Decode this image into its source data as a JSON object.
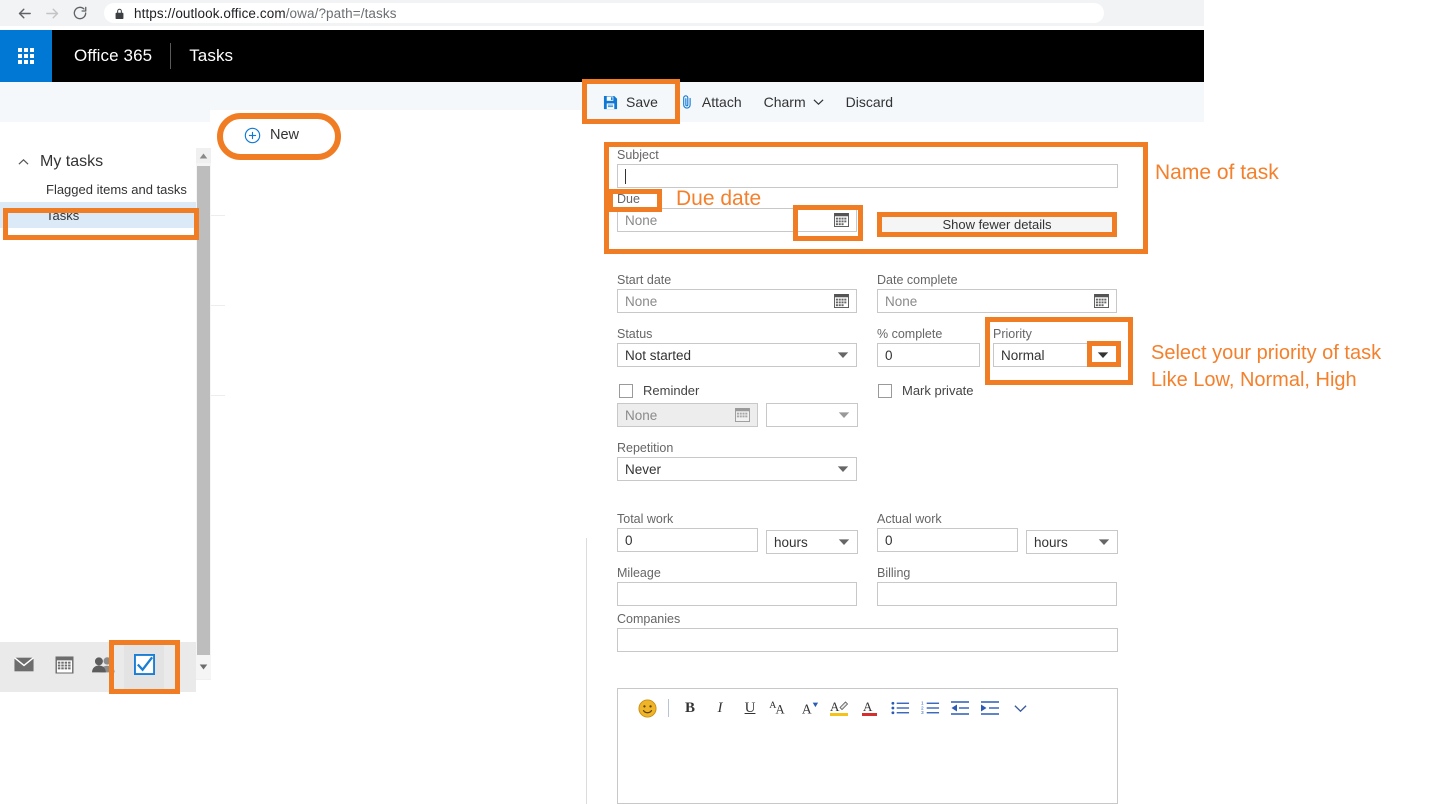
{
  "browser": {
    "back_icon": "arrow-left-icon",
    "forward_icon": "arrow-right-icon",
    "reload_icon": "reload-icon",
    "lock_icon": "lock-icon",
    "url_scheme": "https://outlook.office.com",
    "url_path": "/owa/?path=/tasks",
    "url_full": "https://outlook.office.com/owa/?path=/tasks"
  },
  "suite_bar": {
    "waffle_icon": "app-launcher-icon",
    "brand": "Office 365",
    "app_name": "Tasks"
  },
  "command_bar": {
    "items": [
      {
        "label": "Save",
        "icon": "save-icon",
        "has_chevron": false
      },
      {
        "label": "Attach",
        "icon": "paperclip-icon",
        "has_chevron": false
      },
      {
        "label": "Charm",
        "icon": "",
        "has_chevron": true
      },
      {
        "label": "Discard",
        "icon": "",
        "has_chevron": false
      }
    ]
  },
  "list_pane": {
    "new_button": {
      "label": "New",
      "icon": "plus-circle-icon"
    }
  },
  "sidebar": {
    "group": {
      "label": "My tasks",
      "caret_icon": "chevron-up-icon"
    },
    "items": [
      {
        "label": "Flagged items and tasks",
        "selected": false
      },
      {
        "label": "Tasks",
        "selected": true
      }
    ],
    "scrollbar": {
      "up_icon": "scroll-up-arrow-icon",
      "down_icon": "scroll-down-arrow-icon"
    },
    "modules": [
      {
        "name": "mail-module",
        "icon": "envelope-icon",
        "active": false
      },
      {
        "name": "calendar-module",
        "icon": "calendar-icon",
        "active": false
      },
      {
        "name": "people-module",
        "icon": "people-icon",
        "active": false
      },
      {
        "name": "tasks-module",
        "icon": "checkbox-checked-icon",
        "active": true
      }
    ],
    "overflow_icon": "chevron-down-icon"
  },
  "form": {
    "subject": {
      "label": "Subject",
      "value": "",
      "placeholder": ""
    },
    "due": {
      "label": "Due",
      "value": "None",
      "calendar_icon": "calendar-picker-icon"
    },
    "show_details_button": {
      "label": "Show fewer details"
    },
    "start_date": {
      "label": "Start date",
      "value": "None",
      "calendar_icon": "calendar-picker-icon"
    },
    "date_complete": {
      "label": "Date complete",
      "value": "None",
      "calendar_icon": "calendar-picker-icon"
    },
    "status": {
      "label": "Status",
      "value": "Not started",
      "dropdown_icon": "chevron-down-icon"
    },
    "percent_complete": {
      "label": "% complete",
      "value": "0"
    },
    "priority": {
      "label": "Priority",
      "value": "Normal",
      "dropdown_icon": "chevron-down-icon"
    },
    "reminder": {
      "label": "Reminder",
      "checked": false,
      "date_value": "None",
      "calendar_icon": "calendar-picker-icon",
      "time_value": "",
      "dropdown_icon": "chevron-down-icon"
    },
    "mark_private": {
      "label": "Mark private",
      "checked": false
    },
    "repetition": {
      "label": "Repetition",
      "value": "Never",
      "dropdown_icon": "chevron-down-icon"
    },
    "total_work": {
      "label": "Total work",
      "value": "0",
      "unit": "hours",
      "dropdown_icon": "chevron-down-icon"
    },
    "actual_work": {
      "label": "Actual work",
      "value": "0",
      "unit": "hours",
      "dropdown_icon": "chevron-down-icon"
    },
    "mileage": {
      "label": "Mileage",
      "value": ""
    },
    "billing": {
      "label": "Billing",
      "value": ""
    },
    "companies": {
      "label": "Companies",
      "value": ""
    }
  },
  "editor": {
    "toolbar": [
      {
        "name": "emoji-icon",
        "glyph": "emoji"
      },
      {
        "name": "bold-icon",
        "glyph": "B"
      },
      {
        "name": "italic-icon",
        "glyph": "I"
      },
      {
        "name": "underline-icon",
        "glyph": "U"
      },
      {
        "name": "font-size-icon",
        "glyph": "AA"
      },
      {
        "name": "font-grow-icon",
        "glyph": "A"
      },
      {
        "name": "highlight-icon",
        "glyph": "A-highlight"
      },
      {
        "name": "font-color-icon",
        "glyph": "A-color"
      },
      {
        "name": "bulleted-list-icon",
        "glyph": "bullets"
      },
      {
        "name": "numbered-list-icon",
        "glyph": "numbers"
      },
      {
        "name": "decrease-indent-icon",
        "glyph": "outdent"
      },
      {
        "name": "increase-indent-icon",
        "glyph": "indent"
      },
      {
        "name": "more-formatting-icon",
        "glyph": "chevron-down"
      }
    ],
    "body_value": ""
  },
  "annotations": {
    "accent_color": "#f07d23",
    "text_color": "#f4802c",
    "notes": [
      {
        "id": "name-of-task",
        "text": "Name of task"
      },
      {
        "id": "due-date",
        "text": "Due date"
      },
      {
        "id": "priority-note-line1",
        "text": "Select your priority of task"
      },
      {
        "id": "priority-note-line2",
        "text": "Like Low, Normal, High"
      }
    ],
    "highlight_boxes": [
      "save-button",
      "new-button",
      "tasks-folder",
      "tasks-module",
      "subject-due-group",
      "due-label",
      "due-calendar-button",
      "show-fewer-details-button",
      "priority-group",
      "priority-dropdown-button"
    ]
  }
}
